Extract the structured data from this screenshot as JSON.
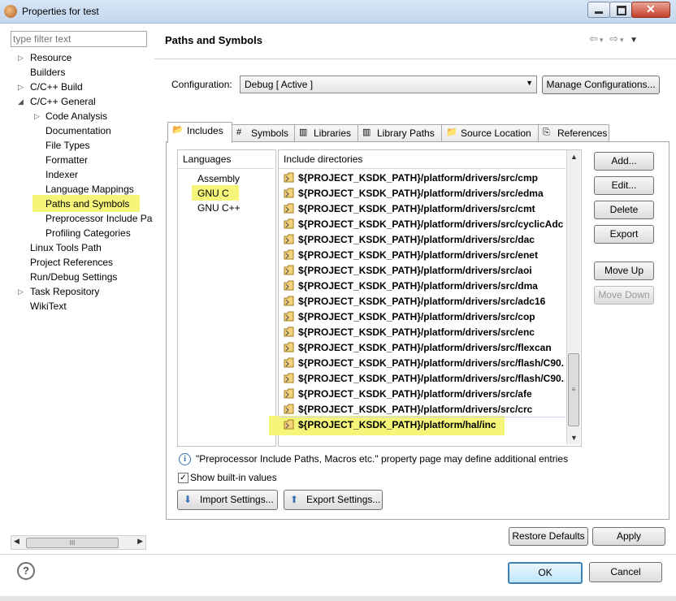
{
  "window": {
    "title": "Properties for test"
  },
  "filter": {
    "placeholder": "type filter text"
  },
  "tree": {
    "items": [
      {
        "label": "Resource",
        "arrow": "▷"
      },
      {
        "label": "Builders",
        "arrow": ""
      },
      {
        "label": "C/C++ Build",
        "arrow": "▷"
      },
      {
        "label": "C/C++ General",
        "arrow": "◢"
      },
      {
        "label": "Code Analysis",
        "arrow": "▷"
      },
      {
        "label": "Documentation",
        "arrow": ""
      },
      {
        "label": "File Types",
        "arrow": ""
      },
      {
        "label": "Formatter",
        "arrow": ""
      },
      {
        "label": "Indexer",
        "arrow": ""
      },
      {
        "label": "Language Mappings",
        "arrow": ""
      },
      {
        "label": "Paths and Symbols",
        "arrow": ""
      },
      {
        "label": "Preprocessor Include Pa",
        "arrow": ""
      },
      {
        "label": "Profiling Categories",
        "arrow": ""
      },
      {
        "label": "Linux Tools Path",
        "arrow": ""
      },
      {
        "label": "Project References",
        "arrow": ""
      },
      {
        "label": "Run/Debug Settings",
        "arrow": ""
      },
      {
        "label": "Task Repository",
        "arrow": "▷"
      },
      {
        "label": "WikiText",
        "arrow": ""
      }
    ]
  },
  "page": {
    "title": "Paths and Symbols",
    "configuration_label": "Configuration:",
    "configuration_value": "Debug  [ Active ]",
    "manage_button": "Manage Configurations..."
  },
  "tabs": [
    {
      "label": "Includes",
      "icon": "📂",
      "active": true
    },
    {
      "label": "Symbols",
      "icon": "#",
      "active": false
    },
    {
      "label": "Libraries",
      "icon": "▥",
      "active": false
    },
    {
      "label": "Library Paths",
      "icon": "▥",
      "active": false
    },
    {
      "label": "Source Location",
      "icon": "📁",
      "active": false
    },
    {
      "label": "References",
      "icon": "⎘",
      "active": false
    }
  ],
  "languages": {
    "header": "Languages",
    "items": [
      "Assembly",
      "GNU C",
      "GNU C++"
    ],
    "selected": "GNU C"
  },
  "includes": {
    "header": "Include directories",
    "items": [
      "${PROJECT_KSDK_PATH}/platform/drivers/src/cmp",
      "${PROJECT_KSDK_PATH}/platform/drivers/src/edma",
      "${PROJECT_KSDK_PATH}/platform/drivers/src/cmt",
      "${PROJECT_KSDK_PATH}/platform/drivers/src/cyclicAdc",
      "${PROJECT_KSDK_PATH}/platform/drivers/src/dac",
      "${PROJECT_KSDK_PATH}/platform/drivers/src/enet",
      "${PROJECT_KSDK_PATH}/platform/drivers/src/aoi",
      "${PROJECT_KSDK_PATH}/platform/drivers/src/dma",
      "${PROJECT_KSDK_PATH}/platform/drivers/src/adc16",
      "${PROJECT_KSDK_PATH}/platform/drivers/src/cop",
      "${PROJECT_KSDK_PATH}/platform/drivers/src/enc",
      "${PROJECT_KSDK_PATH}/platform/drivers/src/flexcan",
      "${PROJECT_KSDK_PATH}/platform/drivers/src/flash/C90...",
      "${PROJECT_KSDK_PATH}/platform/drivers/src/flash/C90...",
      "${PROJECT_KSDK_PATH}/platform/drivers/src/afe",
      "${PROJECT_KSDK_PATH}/platform/drivers/src/crc",
      "${PROJECT_KSDK_PATH}/platform/hal/inc"
    ],
    "highlighted": "${PROJECT_KSDK_PATH}/platform/hal/inc"
  },
  "side_buttons": {
    "add": "Add...",
    "edit": "Edit...",
    "delete": "Delete",
    "export": "Export",
    "move_up": "Move Up",
    "move_down": "Move Down"
  },
  "info_text": "\"Preprocessor Include Paths, Macros etc.\" property page may define additional entries",
  "show_builtin": {
    "label": "Show built-in values",
    "checked": true
  },
  "import_button": "Import Settings...",
  "export_settings_button": "Export Settings...",
  "restore_defaults": "Restore Defaults",
  "apply": "Apply",
  "ok": "OK",
  "cancel": "Cancel",
  "colors": {
    "highlight": "#f5f57a",
    "accent": "#3a6fb0"
  }
}
